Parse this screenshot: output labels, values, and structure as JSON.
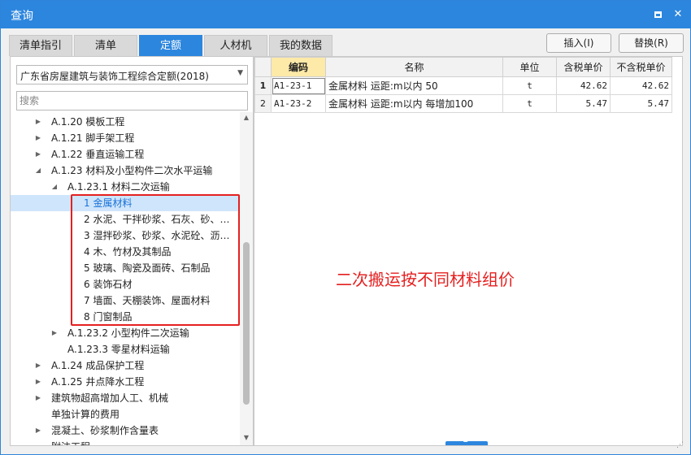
{
  "window": {
    "title": "查询"
  },
  "tabs": [
    "清单指引",
    "清单",
    "定额",
    "人材机",
    "我的数据"
  ],
  "active_tab": "定额",
  "buttons": {
    "insert": "插入(I)",
    "replace": "替换(R)"
  },
  "quota_select": {
    "value": "广东省房屋建筑与装饰工程综合定额(2018)"
  },
  "search": {
    "placeholder": "搜索"
  },
  "tree": [
    {
      "label": "A.1.20 模板工程",
      "toggle": "▶",
      "level": 0
    },
    {
      "label": "A.1.21 脚手架工程",
      "toggle": "▶",
      "level": 0
    },
    {
      "label": "A.1.22 垂直运输工程",
      "toggle": "▶",
      "level": 0
    },
    {
      "label": "A.1.23 材料及小型构件二次水平运输",
      "toggle": "◢",
      "level": 0
    },
    {
      "label": "A.1.23.1 材料二次运输",
      "toggle": "◢",
      "level": 1
    },
    {
      "label": "1 金属材料",
      "toggle": "",
      "level": 2,
      "selected": true
    },
    {
      "label": "2 水泥、干拌砂浆、石灰、砂、…",
      "toggle": "",
      "level": 2
    },
    {
      "label": "3 湿拌砂浆、砂浆、水泥砼、沥…",
      "toggle": "",
      "level": 2
    },
    {
      "label": "4 木、竹材及其制品",
      "toggle": "",
      "level": 2
    },
    {
      "label": "5 玻璃、陶瓷及面砖、石制品",
      "toggle": "",
      "level": 2
    },
    {
      "label": "6 装饰石材",
      "toggle": "",
      "level": 2
    },
    {
      "label": "7 墙面、天棚装饰、屋面材料",
      "toggle": "",
      "level": 2
    },
    {
      "label": "8 门窗制品",
      "toggle": "",
      "level": 2
    },
    {
      "label": "A.1.23.2 小型构件二次运输",
      "toggle": "▶",
      "level": 1
    },
    {
      "label": "A.1.23.3 零星材料运输",
      "toggle": "",
      "level": 1
    },
    {
      "label": "A.1.24 成品保护工程",
      "toggle": "▶",
      "level": 0
    },
    {
      "label": "A.1.25 井点降水工程",
      "toggle": "▶",
      "level": 0
    },
    {
      "label": "建筑物超高增加人工、机械",
      "toggle": "▶",
      "level": 0
    },
    {
      "label": "单独计算的费用",
      "toggle": "",
      "level": 0
    },
    {
      "label": "混凝土、砂浆制作含量表",
      "toggle": "▶",
      "level": 0
    },
    {
      "label": "附注工程",
      "toggle": "",
      "level": 0
    }
  ],
  "grid": {
    "columns": [
      "编码",
      "名称",
      "单位",
      "含税单价",
      "不含税单价"
    ],
    "rows": [
      {
        "no": "1",
        "code": "A1-23-1",
        "name": "金属材料 运距:m以内 50",
        "unit": "t",
        "price_tax": "42.62",
        "price_notax": "42.62"
      },
      {
        "no": "2",
        "code": "A1-23-2",
        "name": "金属材料 运距:m以内 每增加100",
        "unit": "t",
        "price_tax": "5.47",
        "price_notax": "5.47"
      }
    ]
  },
  "annotation": "二次搬运按不同材料组价",
  "icons": {
    "maximize": "maximize-icon",
    "close": "close-icon",
    "dropdown": "chevron-down-icon"
  },
  "colors": {
    "accent": "#2c86de",
    "annotation": "#e52020",
    "selected_row": "#cfe5fb",
    "header_highlight": "#fde9a8"
  }
}
